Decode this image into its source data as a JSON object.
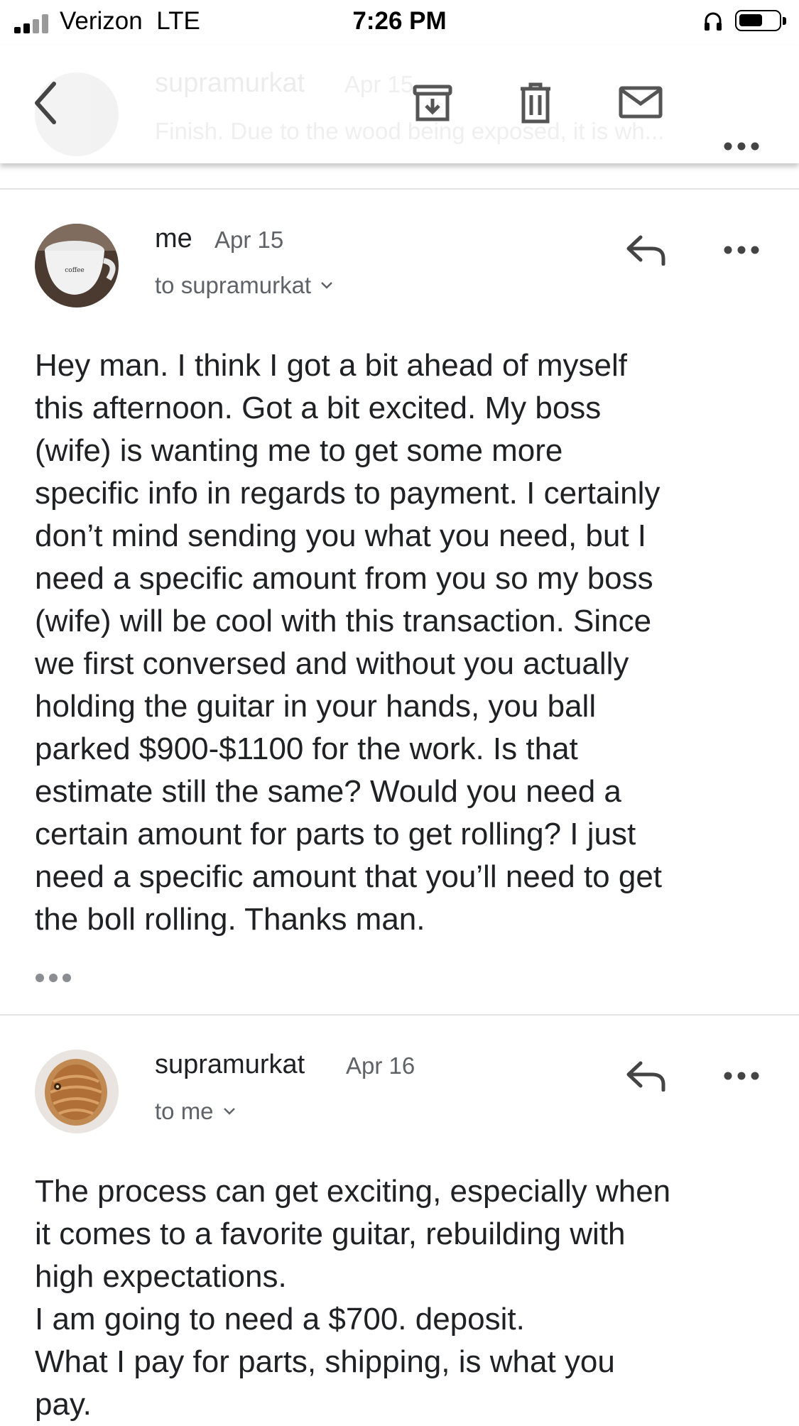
{
  "status_bar": {
    "carrier": "Verizon",
    "network": "LTE",
    "time": "7:26 PM"
  },
  "collapsed_message": {
    "sender": "supramurkat",
    "date": "Apr 15",
    "snippet": "Finish. Due to the wood being exposed, it is wh..."
  },
  "toolbar": {
    "icons": [
      "back-icon",
      "archive-icon",
      "trash-icon",
      "mail-icon",
      "more-icon"
    ]
  },
  "messages": [
    {
      "sender": "me",
      "date": "Apr 15",
      "recipient": "to supramurkat",
      "body_lines": [
        "Hey man. I think I got a bit ahead of myself",
        "this afternoon. Got a bit excited. My boss",
        "(wife) is wanting me to get some more",
        "specific info in regards to payment. I certainly",
        "don’t mind sending you what you need, but I",
        "need a specific amount from you so my boss",
        "(wife) will be cool with this transaction. Since",
        "we first conversed and without you actually",
        "holding the guitar in your hands, you ball",
        "parked $900-$1100 for the work. Is that",
        "estimate still the same? Would you need a",
        "certain amount for parts to get rolling? I just",
        "need a specific amount that you’ll need to get",
        "the boll rolling. Thanks man."
      ],
      "avatar_text": "coffee"
    },
    {
      "sender": "supramurkat",
      "date": "Apr 16",
      "recipient": "to me",
      "body_lines": [
        "The process can get exciting, especially when",
        "it comes to a favorite guitar, rebuilding with",
        "high expectations.",
        "I am going to need a $700. deposit.",
        "What I pay for parts, shipping, is what you",
        "pay."
      ]
    }
  ]
}
